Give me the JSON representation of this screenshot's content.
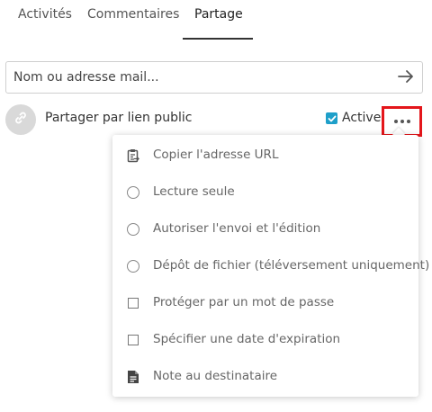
{
  "tabs": [
    {
      "label": "Activités",
      "active": false
    },
    {
      "label": "Commentaires",
      "active": false
    },
    {
      "label": "Partage",
      "active": true
    }
  ],
  "search": {
    "placeholder": "Nom ou adresse mail...",
    "value": ""
  },
  "share_link": {
    "label": "Partager par lien public",
    "enable_label": "Activer",
    "enabled": true,
    "more_icon": "ellipsis-icon"
  },
  "menu": {
    "items": [
      {
        "label": "Copier l'adresse URL",
        "icon": "clipboard-icon"
      },
      {
        "label": "Lecture seule",
        "icon": "radio-icon"
      },
      {
        "label": "Autoriser l'envoi et l'édition",
        "icon": "radio-icon"
      },
      {
        "label": "Dépôt de fichier (téléversement uniquement)",
        "icon": "radio-icon"
      },
      {
        "label": "Protéger par un mot de passe",
        "icon": "checkbox-icon"
      },
      {
        "label": "Spécifier une date d'expiration",
        "icon": "checkbox-icon"
      },
      {
        "label": "Note au destinataire",
        "icon": "note-icon"
      }
    ]
  },
  "colors": {
    "accent": "#1e9fc9",
    "highlight": "#e4161b"
  }
}
